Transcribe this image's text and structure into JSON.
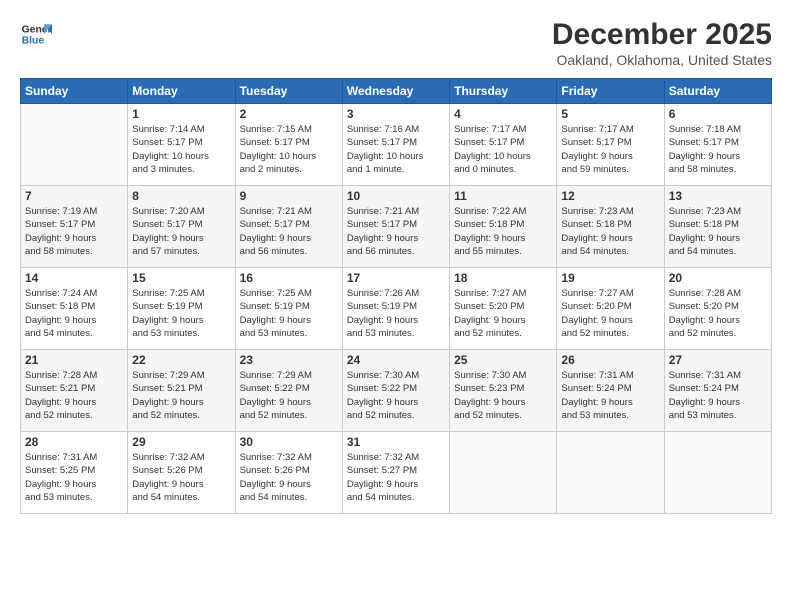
{
  "header": {
    "logo_general": "General",
    "logo_blue": "Blue",
    "month_title": "December 2025",
    "location": "Oakland, Oklahoma, United States"
  },
  "days_of_week": [
    "Sunday",
    "Monday",
    "Tuesday",
    "Wednesday",
    "Thursday",
    "Friday",
    "Saturday"
  ],
  "weeks": [
    [
      {
        "day": "",
        "info": ""
      },
      {
        "day": "1",
        "info": "Sunrise: 7:14 AM\nSunset: 5:17 PM\nDaylight: 10 hours\nand 3 minutes."
      },
      {
        "day": "2",
        "info": "Sunrise: 7:15 AM\nSunset: 5:17 PM\nDaylight: 10 hours\nand 2 minutes."
      },
      {
        "day": "3",
        "info": "Sunrise: 7:16 AM\nSunset: 5:17 PM\nDaylight: 10 hours\nand 1 minute."
      },
      {
        "day": "4",
        "info": "Sunrise: 7:17 AM\nSunset: 5:17 PM\nDaylight: 10 hours\nand 0 minutes."
      },
      {
        "day": "5",
        "info": "Sunrise: 7:17 AM\nSunset: 5:17 PM\nDaylight: 9 hours\nand 59 minutes."
      },
      {
        "day": "6",
        "info": "Sunrise: 7:18 AM\nSunset: 5:17 PM\nDaylight: 9 hours\nand 58 minutes."
      }
    ],
    [
      {
        "day": "7",
        "info": "Sunrise: 7:19 AM\nSunset: 5:17 PM\nDaylight: 9 hours\nand 58 minutes."
      },
      {
        "day": "8",
        "info": "Sunrise: 7:20 AM\nSunset: 5:17 PM\nDaylight: 9 hours\nand 57 minutes."
      },
      {
        "day": "9",
        "info": "Sunrise: 7:21 AM\nSunset: 5:17 PM\nDaylight: 9 hours\nand 56 minutes."
      },
      {
        "day": "10",
        "info": "Sunrise: 7:21 AM\nSunset: 5:17 PM\nDaylight: 9 hours\nand 56 minutes."
      },
      {
        "day": "11",
        "info": "Sunrise: 7:22 AM\nSunset: 5:18 PM\nDaylight: 9 hours\nand 55 minutes."
      },
      {
        "day": "12",
        "info": "Sunrise: 7:23 AM\nSunset: 5:18 PM\nDaylight: 9 hours\nand 54 minutes."
      },
      {
        "day": "13",
        "info": "Sunrise: 7:23 AM\nSunset: 5:18 PM\nDaylight: 9 hours\nand 54 minutes."
      }
    ],
    [
      {
        "day": "14",
        "info": "Sunrise: 7:24 AM\nSunset: 5:18 PM\nDaylight: 9 hours\nand 54 minutes."
      },
      {
        "day": "15",
        "info": "Sunrise: 7:25 AM\nSunset: 5:19 PM\nDaylight: 9 hours\nand 53 minutes."
      },
      {
        "day": "16",
        "info": "Sunrise: 7:25 AM\nSunset: 5:19 PM\nDaylight: 9 hours\nand 53 minutes."
      },
      {
        "day": "17",
        "info": "Sunrise: 7:26 AM\nSunset: 5:19 PM\nDaylight: 9 hours\nand 53 minutes."
      },
      {
        "day": "18",
        "info": "Sunrise: 7:27 AM\nSunset: 5:20 PM\nDaylight: 9 hours\nand 52 minutes."
      },
      {
        "day": "19",
        "info": "Sunrise: 7:27 AM\nSunset: 5:20 PM\nDaylight: 9 hours\nand 52 minutes."
      },
      {
        "day": "20",
        "info": "Sunrise: 7:28 AM\nSunset: 5:20 PM\nDaylight: 9 hours\nand 52 minutes."
      }
    ],
    [
      {
        "day": "21",
        "info": "Sunrise: 7:28 AM\nSunset: 5:21 PM\nDaylight: 9 hours\nand 52 minutes."
      },
      {
        "day": "22",
        "info": "Sunrise: 7:29 AM\nSunset: 5:21 PM\nDaylight: 9 hours\nand 52 minutes."
      },
      {
        "day": "23",
        "info": "Sunrise: 7:29 AM\nSunset: 5:22 PM\nDaylight: 9 hours\nand 52 minutes."
      },
      {
        "day": "24",
        "info": "Sunrise: 7:30 AM\nSunset: 5:22 PM\nDaylight: 9 hours\nand 52 minutes."
      },
      {
        "day": "25",
        "info": "Sunrise: 7:30 AM\nSunset: 5:23 PM\nDaylight: 9 hours\nand 52 minutes."
      },
      {
        "day": "26",
        "info": "Sunrise: 7:31 AM\nSunset: 5:24 PM\nDaylight: 9 hours\nand 53 minutes."
      },
      {
        "day": "27",
        "info": "Sunrise: 7:31 AM\nSunset: 5:24 PM\nDaylight: 9 hours\nand 53 minutes."
      }
    ],
    [
      {
        "day": "28",
        "info": "Sunrise: 7:31 AM\nSunset: 5:25 PM\nDaylight: 9 hours\nand 53 minutes."
      },
      {
        "day": "29",
        "info": "Sunrise: 7:32 AM\nSunset: 5:26 PM\nDaylight: 9 hours\nand 54 minutes."
      },
      {
        "day": "30",
        "info": "Sunrise: 7:32 AM\nSunset: 5:26 PM\nDaylight: 9 hours\nand 54 minutes."
      },
      {
        "day": "31",
        "info": "Sunrise: 7:32 AM\nSunset: 5:27 PM\nDaylight: 9 hours\nand 54 minutes."
      },
      {
        "day": "",
        "info": ""
      },
      {
        "day": "",
        "info": ""
      },
      {
        "day": "",
        "info": ""
      }
    ]
  ]
}
